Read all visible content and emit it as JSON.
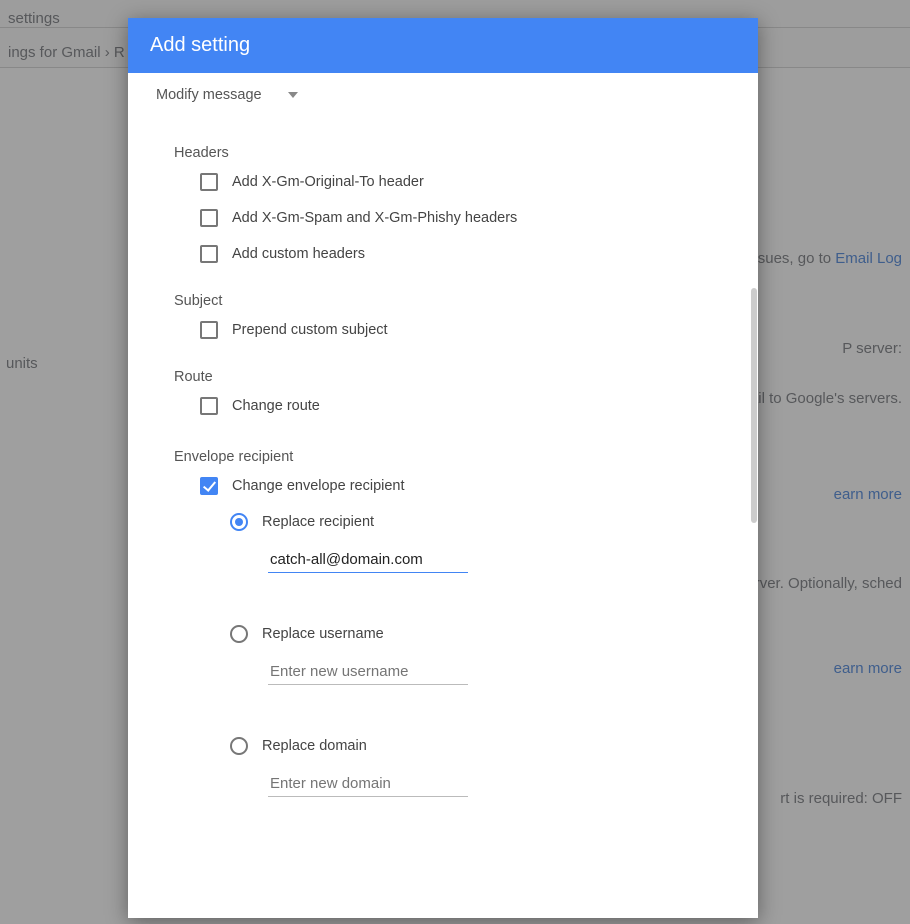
{
  "background": {
    "settings_title": "settings",
    "breadcrumb_left": "ings for Gmail  ›  R",
    "units_label": "units",
    "r1_text": "ssues, go to ",
    "r1_link": "Email Log",
    "r2_text": "P server:",
    "r3_text": "ail to Google's servers.",
    "r4_link": "earn more",
    "r5_text": "erver. Optionally, sched",
    "r6_link": "earn more",
    "r7_text": "rt is required: OFF"
  },
  "modal": {
    "title": "Add setting",
    "action_dropdown": "Modify message",
    "sections": {
      "headers": {
        "label": "Headers",
        "items": {
          "original_to": {
            "label": "Add X-Gm-Original-To header",
            "checked": false
          },
          "spam_phishy": {
            "label": "Add X-Gm-Spam and X-Gm-Phishy headers",
            "checked": false
          },
          "custom": {
            "label": "Add custom headers",
            "checked": false
          }
        }
      },
      "subject": {
        "label": "Subject",
        "items": {
          "prepend": {
            "label": "Prepend custom subject",
            "checked": false
          }
        }
      },
      "route": {
        "label": "Route",
        "items": {
          "change_route": {
            "label": "Change route",
            "checked": false
          }
        }
      },
      "envelope": {
        "label": "Envelope recipient",
        "change": {
          "label": "Change envelope recipient",
          "checked": true
        },
        "options": {
          "replace_recipient": {
            "label": "Replace recipient",
            "selected": true,
            "value": "catch-all@domain.com"
          },
          "replace_username": {
            "label": "Replace username",
            "selected": false,
            "placeholder": "Enter new username"
          },
          "replace_domain": {
            "label": "Replace domain",
            "selected": false,
            "placeholder": "Enter new domain"
          }
        }
      }
    }
  }
}
